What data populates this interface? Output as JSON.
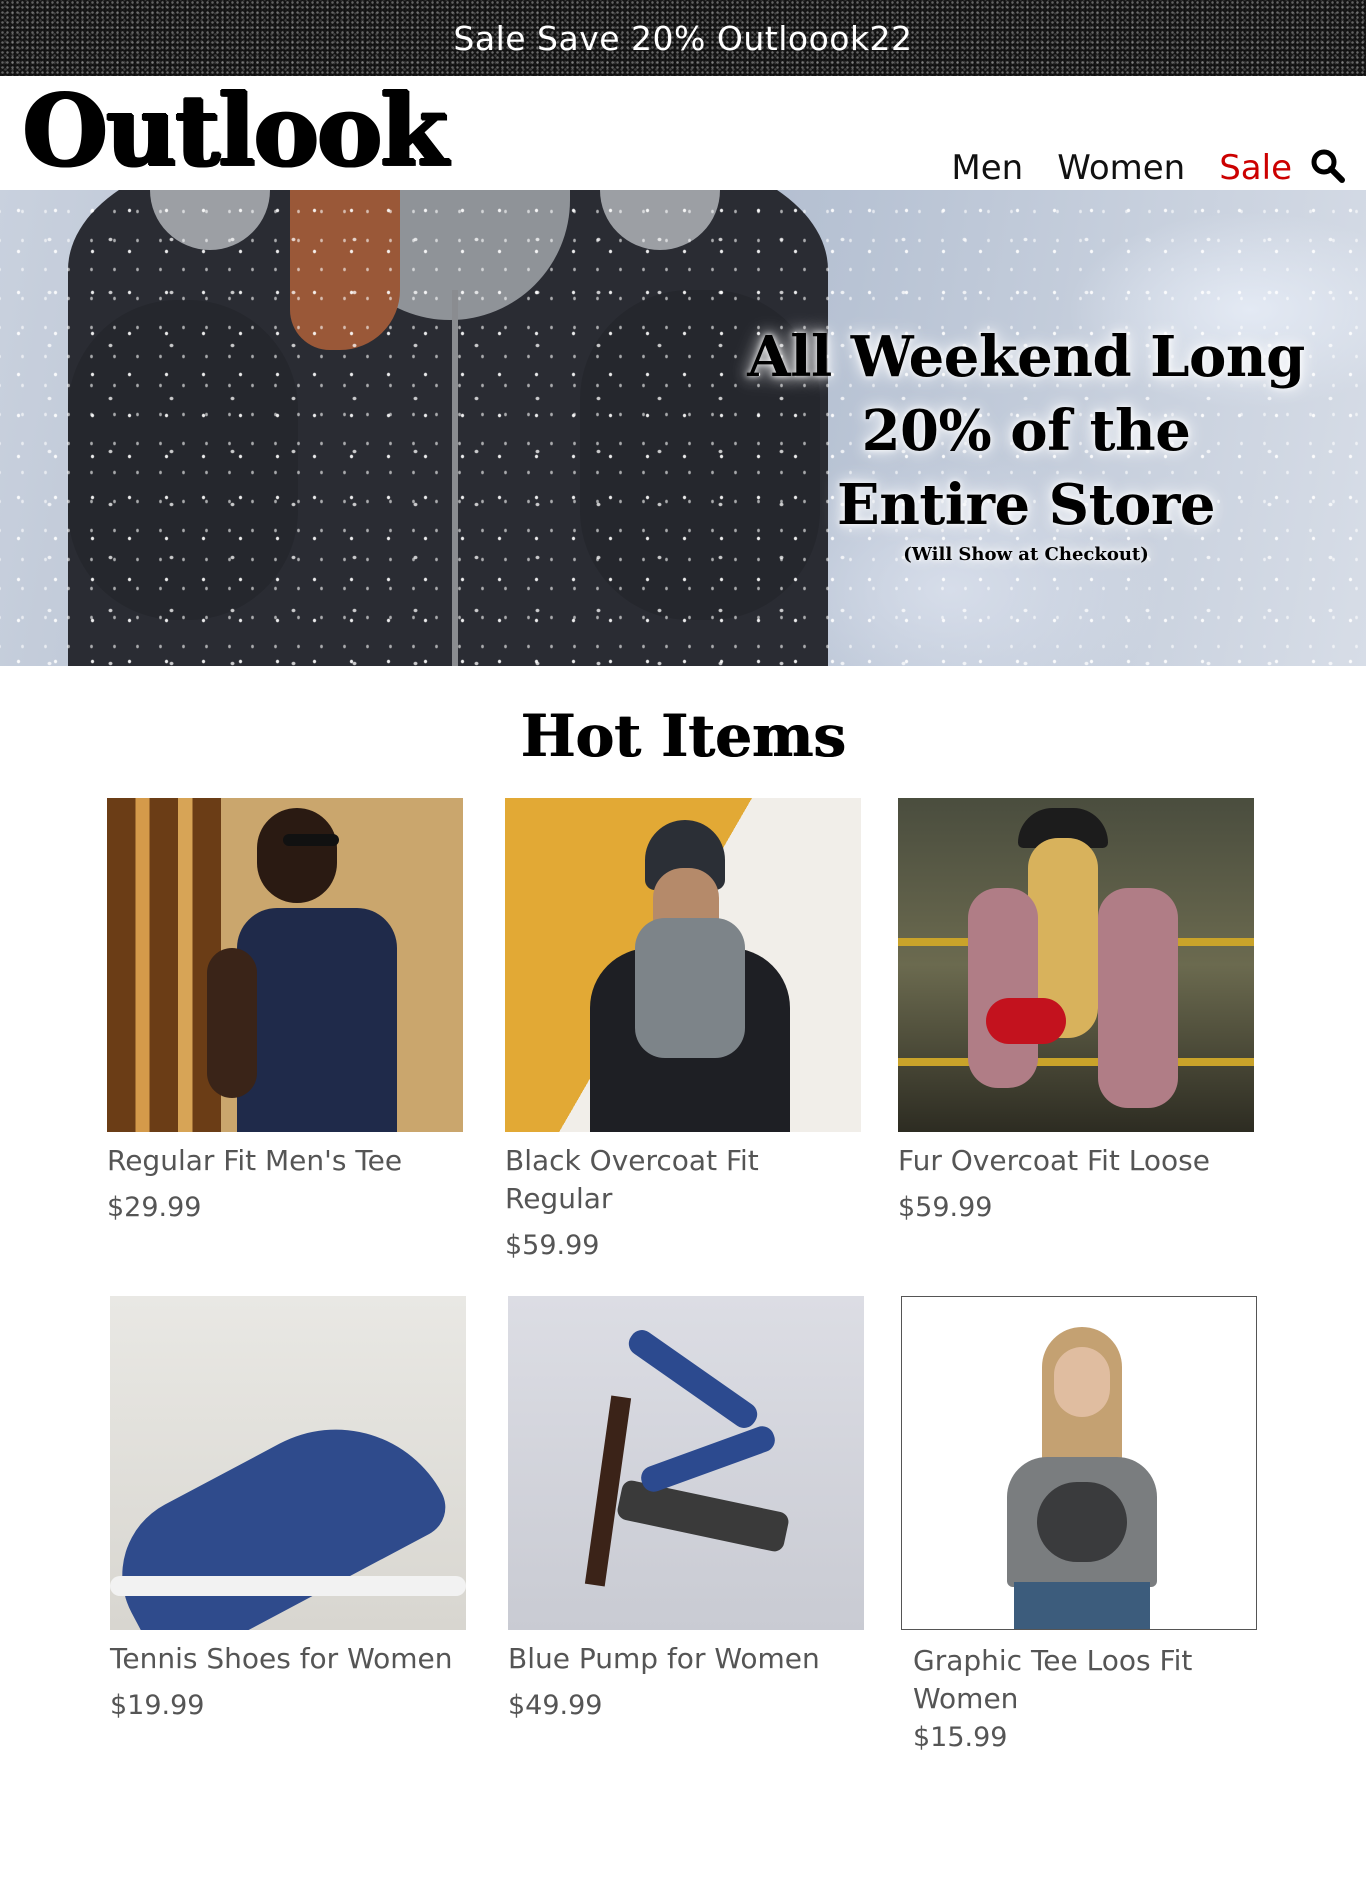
{
  "promo": {
    "text": "Sale Save 20% Outloook22"
  },
  "header": {
    "logo": "Outlook",
    "nav": [
      {
        "label": "Men"
      },
      {
        "label": "Women"
      },
      {
        "label": "Sale"
      }
    ]
  },
  "hero": {
    "lines": [
      "All Weekend Long",
      "20% of the",
      "Entire Store"
    ],
    "note": "(Will Show at Checkout)"
  },
  "hot_items": {
    "title": "Hot Items",
    "products": [
      {
        "name": "Regular Fit Men's Tee",
        "price": "$29.99"
      },
      {
        "name": "Black Overcoat Fit Regular",
        "price": "$59.99"
      },
      {
        "name": "Fur Overcoat Fit Loose",
        "price": "$59.99"
      },
      {
        "name": "Tennis Shoes for Women",
        "price": "$19.99"
      },
      {
        "name": "Blue Pump for Women",
        "price": "$49.99"
      },
      {
        "name": "Graphic Tee Loos Fit Women",
        "price": "$15.99"
      }
    ]
  },
  "colors": {
    "sale_accent": "#cc0000",
    "text_muted": "#555555"
  }
}
